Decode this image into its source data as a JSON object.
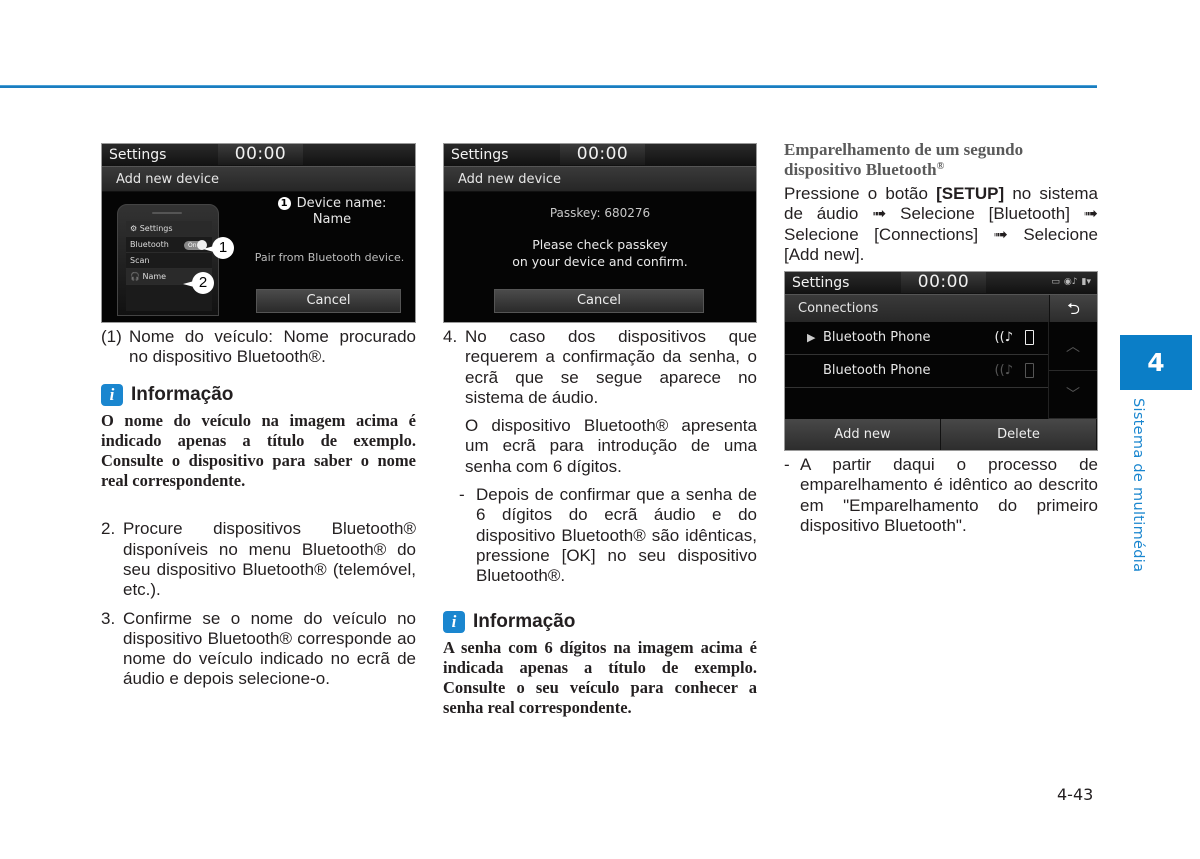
{
  "page": {
    "chapter_number": "4",
    "chapter_title": "Sistema de multimédia",
    "page_number": "4-43",
    "accent_color": "#1a86cf"
  },
  "screen1": {
    "title": "Settings",
    "clock": "00:00",
    "subtitle": "Add new device",
    "phone": {
      "settings": "⚙ Settings",
      "bluetooth": "Bluetooth",
      "toggle": "On",
      "scan": "Scan",
      "name": "🎧 Name"
    },
    "callout_1": "1",
    "callout_2": "2",
    "badge": "1",
    "device_name_label": "Device name:",
    "device_name_value": "Name",
    "pair_text": "Pair from Bluetooth device.",
    "cancel": "Cancel"
  },
  "screen2": {
    "title": "Settings",
    "clock": "00:00",
    "subtitle": "Add new device",
    "passkey": "Passkey: 680276",
    "check_line1": "Please check passkey",
    "check_line2": "on your device and confirm.",
    "cancel": "Cancel"
  },
  "screen3": {
    "title": "Settings",
    "clock": "00:00",
    "status_icons": [
      "battery-icon",
      "bluetooth-audio-icon",
      "signal-icon"
    ],
    "header": "Connections",
    "back": "⮌",
    "devices": [
      {
        "name": "Bluetooth Phone",
        "selected": true,
        "play": "▶",
        "audio": "((♪"
      },
      {
        "name": "Bluetooth Phone",
        "selected": false,
        "play": "",
        "audio": "((♪"
      }
    ],
    "scroll_up": "︿",
    "scroll_down": "﹀",
    "add_new": "Add new",
    "delete": "Delete"
  },
  "col1": {
    "item1_marker": "(1)",
    "item1_text": "Nome do veículo: Nome procurado no dispositivo Bluetooth®.",
    "info_icon": "i",
    "info_title": "Informação",
    "info_body": "O nome do veículo na imagem acima é indicado apenas a título de exemplo. Consulte o dispositivo para saber o nome real correspondente.",
    "step2_marker": "2.",
    "step2_text": "Procure dispositivos Bluetooth® disponíveis no menu Bluetooth® do seu dispositivo Bluetooth® (telemóvel, etc.).",
    "step3_marker": "3.",
    "step3_text": "Confirme se o nome do veículo no dispositivo Bluetooth® corresponde ao nome do veículo indicado no ecrã de áudio e depois selecione-o."
  },
  "col2": {
    "step4_marker": "4.",
    "step4_text": "No caso dos dispositivos que requerem a confirmação da senha, o ecrã que se segue aparece no sistema de áudio.",
    "step4_para": "O dispositivo Bluetooth® apresenta um ecrã para introdução de uma senha com 6 dígitos.",
    "dash_marker": "-",
    "dash_text": "Depois de confirmar que a senha de 6 dígitos do ecrã áudio e do dispositivo Bluetooth® são idênticas, pressione [OK] no seu dispositivo Bluetooth®.",
    "info_icon": "i",
    "info_title": "Informação",
    "info_body": "A senha com 6 dígitos na imagem acima é indicada apenas a título de exemplo. Consulte o seu veículo para conhecer a senha real correspondente."
  },
  "col3": {
    "section_title": "Emparelhamento de um segundo dispositivo Bluetooth",
    "section_title_reg": "®",
    "instr_pre": "Pressione o botão ",
    "instr_setup": "[SETUP]",
    "instr_post": " no sistema de áudio ➟ Selecione [Bluetooth] ➟ Selecione [Connections] ➟ Selecione [Add new].",
    "dash_marker": "-",
    "dash_text": "A partir daqui o processo de emparelhamento é idêntico ao descrito em \"Emparelhamento do primeiro dispositivo Bluetooth\"."
  }
}
